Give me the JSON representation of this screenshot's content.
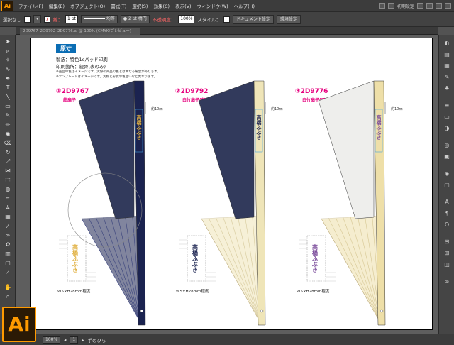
{
  "menubar": {
    "logo": "Ai",
    "items": [
      "ファイル(F)",
      "編集(E)",
      "オブジェクト(O)",
      "書式(T)",
      "選択(S)",
      "効果(C)",
      "表示(V)",
      "ウィンドウ(W)",
      "ヘルプ(H)"
    ],
    "workspace": "初期設定"
  },
  "control": {
    "selection": "選択なし",
    "stroke_label": "線：",
    "stroke_value": "1 pt",
    "stroke_style": "均等",
    "brush": "2 pt 楕円",
    "opacity_label": "不透明度：",
    "opacity_value": "100%",
    "style_label": "スタイル：",
    "doc_settings": "ドキュメント設定",
    "env_settings": "環境設定"
  },
  "document": {
    "tab_name": "2D9767_2D9792_2D9776.ai @ 100% (CMYK/プレビュー)"
  },
  "artwork": {
    "header": "原寸",
    "spec_line1": "製法：特色1cパッド印刷",
    "spec_line2": "印刷箇所：親骨(表のみ)",
    "note1": "※画面の色はイメージです。実際の商品の色とは異なる場合があります。",
    "note2": "※テンプレートはイメージです。実物と形状や色合いなど異なります。",
    "products": [
      {
        "number": "①2D9767",
        "name": "紺扇子",
        "fan_color": "#323a5c",
        "rib_color": "#1b2350",
        "print_color": "#e0b040",
        "print_text": "高橋ふぶき",
        "dim": "約10㎜",
        "size": "W5×H28mm程度"
      },
      {
        "number": "②2D9792",
        "name": "白竹扇子(花火)",
        "fan_color": "#323a5c",
        "rib_color": "#efe5b8",
        "print_color": "#1b2350",
        "print_text": "高橋ふぶき",
        "dim": "約10㎜",
        "size": "W5×H28mm程度"
      },
      {
        "number": "③2D9776",
        "name": "白竹扇子(てまり)",
        "fan_color": "#eeeeec",
        "rib_color": "#eedfa8",
        "print_color": "#7a4a9a",
        "print_text": "高橋ふぶき",
        "dim": "約10㎜",
        "size": "W5×H28mm程度"
      }
    ]
  },
  "status": {
    "zoom": "100%",
    "page": "1",
    "tool": "手のひら"
  },
  "colors": {
    "accent": "#ff9a00",
    "header_blue": "#0a6db4",
    "product_pink": "#e6007e"
  },
  "icons": {
    "tools": [
      "selection-icon",
      "direct-selection-icon",
      "magic-wand-icon",
      "lasso-icon",
      "pen-icon",
      "type-icon",
      "line-icon",
      "rectangle-icon",
      "paintbrush-icon",
      "pencil-icon",
      "blob-brush-icon",
      "eraser-icon",
      "rotate-icon",
      "scale-icon",
      "width-icon",
      "free-transform-icon",
      "shape-builder-icon",
      "perspective-icon",
      "mesh-icon",
      "gradient-icon",
      "eyedropper-icon",
      "blend-icon",
      "symbol-sprayer-icon",
      "graph-icon",
      "artboard-icon",
      "slice-icon",
      "hand-icon",
      "zoom-icon"
    ],
    "panels": [
      "color-icon",
      "color-guide-icon",
      "swatches-icon",
      "brushes-icon",
      "symbols-icon",
      "stroke-icon",
      "gradient-panel-icon",
      "transparency-icon",
      "appearance-icon",
      "graphic-styles-icon",
      "layers-icon",
      "artboards-panel-icon",
      "character-icon",
      "paragraph-icon",
      "opentype-icon",
      "align-icon",
      "transform-icon",
      "pathfinder-icon",
      "links-icon"
    ]
  }
}
